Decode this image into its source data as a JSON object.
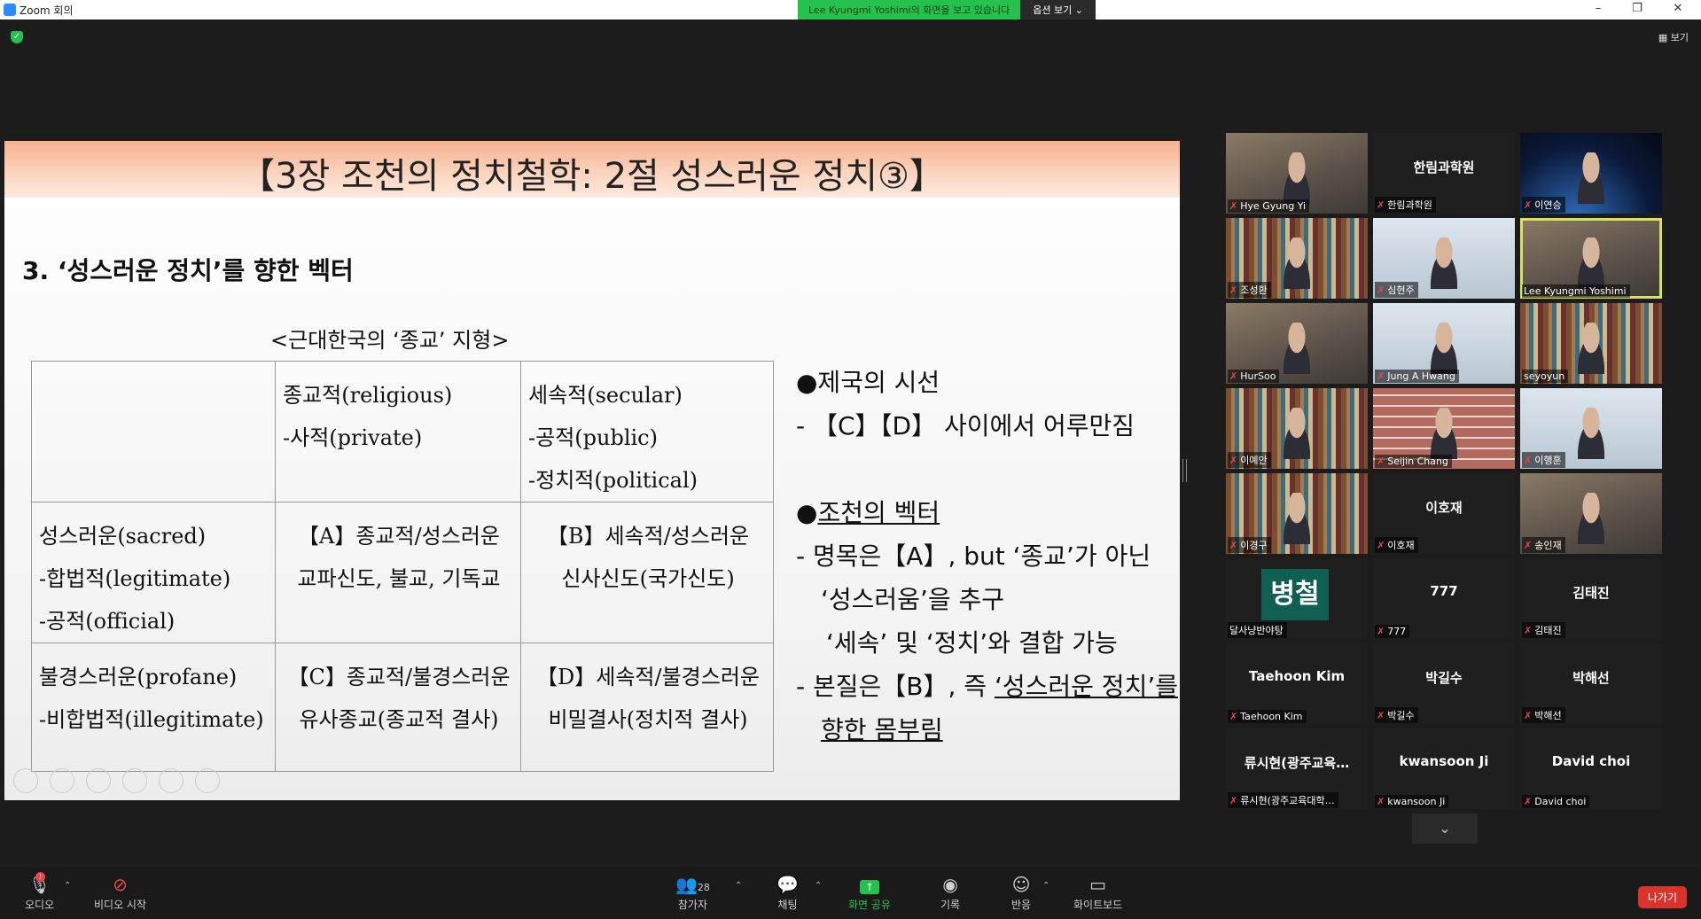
{
  "window": {
    "title": "Zoom 회의"
  },
  "share_banner": {
    "viewing_text": "Lee  Kyungmi  Yoshimi의 화면을 보고 있습니다",
    "options_label": "옵션 보기 ⌄"
  },
  "view_button": "보기",
  "slide": {
    "title": "【3장 조천의 정치철학: 2절 성스러운 정치③】",
    "heading": "3. ‘성스러운 정치’를 향한 벡터",
    "table_caption": "<근대한국의 ‘종교’ 지형>",
    "table": {
      "r1": {
        "c2": [
          "종교적(religious)",
          "-사적(private)"
        ],
        "c3": [
          "세속적(secular)",
          "-공적(public)",
          "-정치적(political)"
        ]
      },
      "r2": {
        "c1": [
          "성스러운(sacred)",
          "-합법적(legitimate)",
          "-공적(official)"
        ],
        "c2": [
          "【A】종교적/성스러운",
          "교파신도, 불교, 기독교"
        ],
        "c3": [
          "【B】세속적/성스러운",
          "신사신도(국가신도)"
        ]
      },
      "r3": {
        "c1": [
          "불경스러운(profane)",
          "-비합법적(illegitimate)"
        ],
        "c2": [
          "【C】종교적/불경스러운",
          "유사종교(종교적 결사)"
        ],
        "c3": [
          "【D】세속적/불경스러운",
          "비밀결사(정치적 결사)"
        ]
      }
    },
    "side": {
      "b1_title": "●제국의 시선",
      "b1_line": "- 【C】【D】 사이에서 어루만짐",
      "b2_bullet": "●",
      "b2_title": "조천의 벡터",
      "b2_l1": "- 명목은【A】, but ‘종교’가 아닌",
      "b2_l2": "‘성스러움’을 추구",
      "b2_l3": "‘세속’ 및 ‘정치’와 결합 가능",
      "b2_l4a": "- 본질은【B】, 즉 ",
      "b2_l4b": "‘성스러운 정치’를",
      "b2_l5": "향한 몸부림"
    }
  },
  "participants": [
    {
      "name": "Hye Gyung Yi"
    },
    {
      "name": "한림과학원",
      "center": "한림과학원"
    },
    {
      "name": "이연승"
    },
    {
      "name": "조성환"
    },
    {
      "name": "심현주"
    },
    {
      "name": "Lee Kyungmi Yoshimi"
    },
    {
      "name": "HurSoo"
    },
    {
      "name": "Jung A Hwang"
    },
    {
      "name": "seyoyun"
    },
    {
      "name": "이예안"
    },
    {
      "name": "Seijin Chang"
    },
    {
      "name": "이행훈"
    },
    {
      "name": "이경구"
    },
    {
      "name": "이호재",
      "center": "이호재"
    },
    {
      "name": "송인재"
    },
    {
      "name": "달사냥반야탕",
      "avatar": "병철"
    },
    {
      "name": "777",
      "center": "777"
    },
    {
      "name": "김태진",
      "center": "김태진"
    },
    {
      "name": "Taehoon Kim",
      "center": "Taehoon Kim"
    },
    {
      "name": "박길수",
      "center": "박길수"
    },
    {
      "name": "박해선",
      "center": "박해선"
    },
    {
      "name": "류시현(광주교육대학…",
      "center": "류시현(광주교육…"
    },
    {
      "name": "kwansoon Ji",
      "center": "kwansoon Ji"
    },
    {
      "name": "David choi",
      "center": "David choi"
    }
  ],
  "toolbar": {
    "audio": "오디오",
    "video": "비디오 시작",
    "participants": "참가자",
    "participants_count": "28",
    "chat": "채팅",
    "share": "화면 공유",
    "record": "기록",
    "reactions": "반응",
    "whiteboard": "화이트보드",
    "leave": "나가기"
  },
  "icons": {
    "mic": "microphone-off-icon",
    "video": "video-off-icon",
    "people": "people-icon",
    "chat": "chat-bubble-icon",
    "share": "share-screen-icon",
    "record": "record-icon",
    "reactions": "smiley-icon",
    "whiteboard": "whiteboard-icon"
  }
}
